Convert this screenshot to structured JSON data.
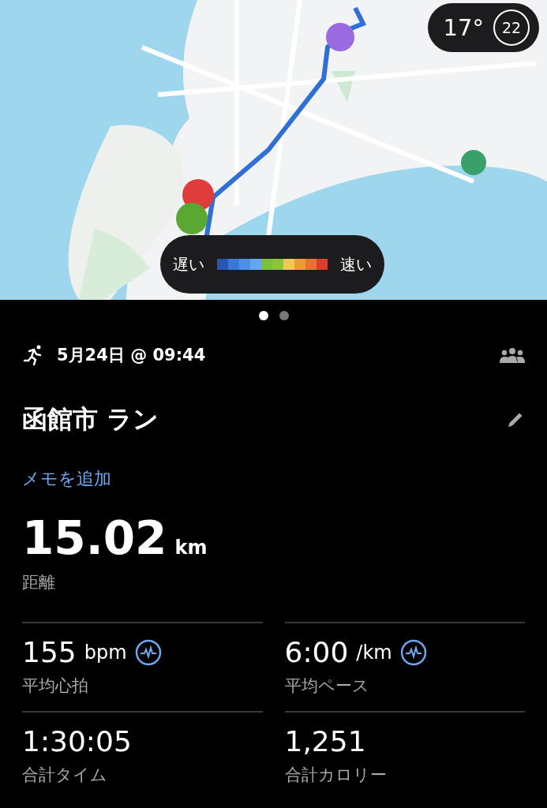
{
  "map": {
    "kind": "picture",
    "weather": {
      "temperature": "17°",
      "badge": "22"
    },
    "legend": {
      "slow": "遅い",
      "fast": "速い",
      "segments": [
        {
          "color": "#2a55b0"
        },
        {
          "color": "#3a78d8"
        },
        {
          "color": "#4d8ee8"
        },
        {
          "color": "#65a6f0"
        },
        {
          "color": "#7cbf3a"
        },
        {
          "color": "#8cc43c"
        },
        {
          "color": "#f2c55a"
        },
        {
          "color": "#ee9a3a"
        },
        {
          "color": "#e6742e"
        },
        {
          "color": "#d9402e"
        }
      ]
    }
  },
  "pager": [
    {
      "selected": true
    },
    {
      "selected": false
    }
  ],
  "activity": {
    "datetime": "5月24日 @ 09:44",
    "title": "函館市 ラン",
    "add_note": "メモを追加"
  },
  "distance": {
    "value": "15.02",
    "unit": "km",
    "label": "距離"
  },
  "stats": [
    {
      "value": "155",
      "unit": "bpm",
      "label": "平均心拍",
      "chart": true
    },
    {
      "value": "6:00",
      "unit": "/km",
      "label": "平均ペース",
      "chart": true
    },
    {
      "value": "1:30:05",
      "label": "合計タイム",
      "chart": false
    },
    {
      "value": "1,251",
      "label": "合計カロリー",
      "chart": false
    }
  ]
}
